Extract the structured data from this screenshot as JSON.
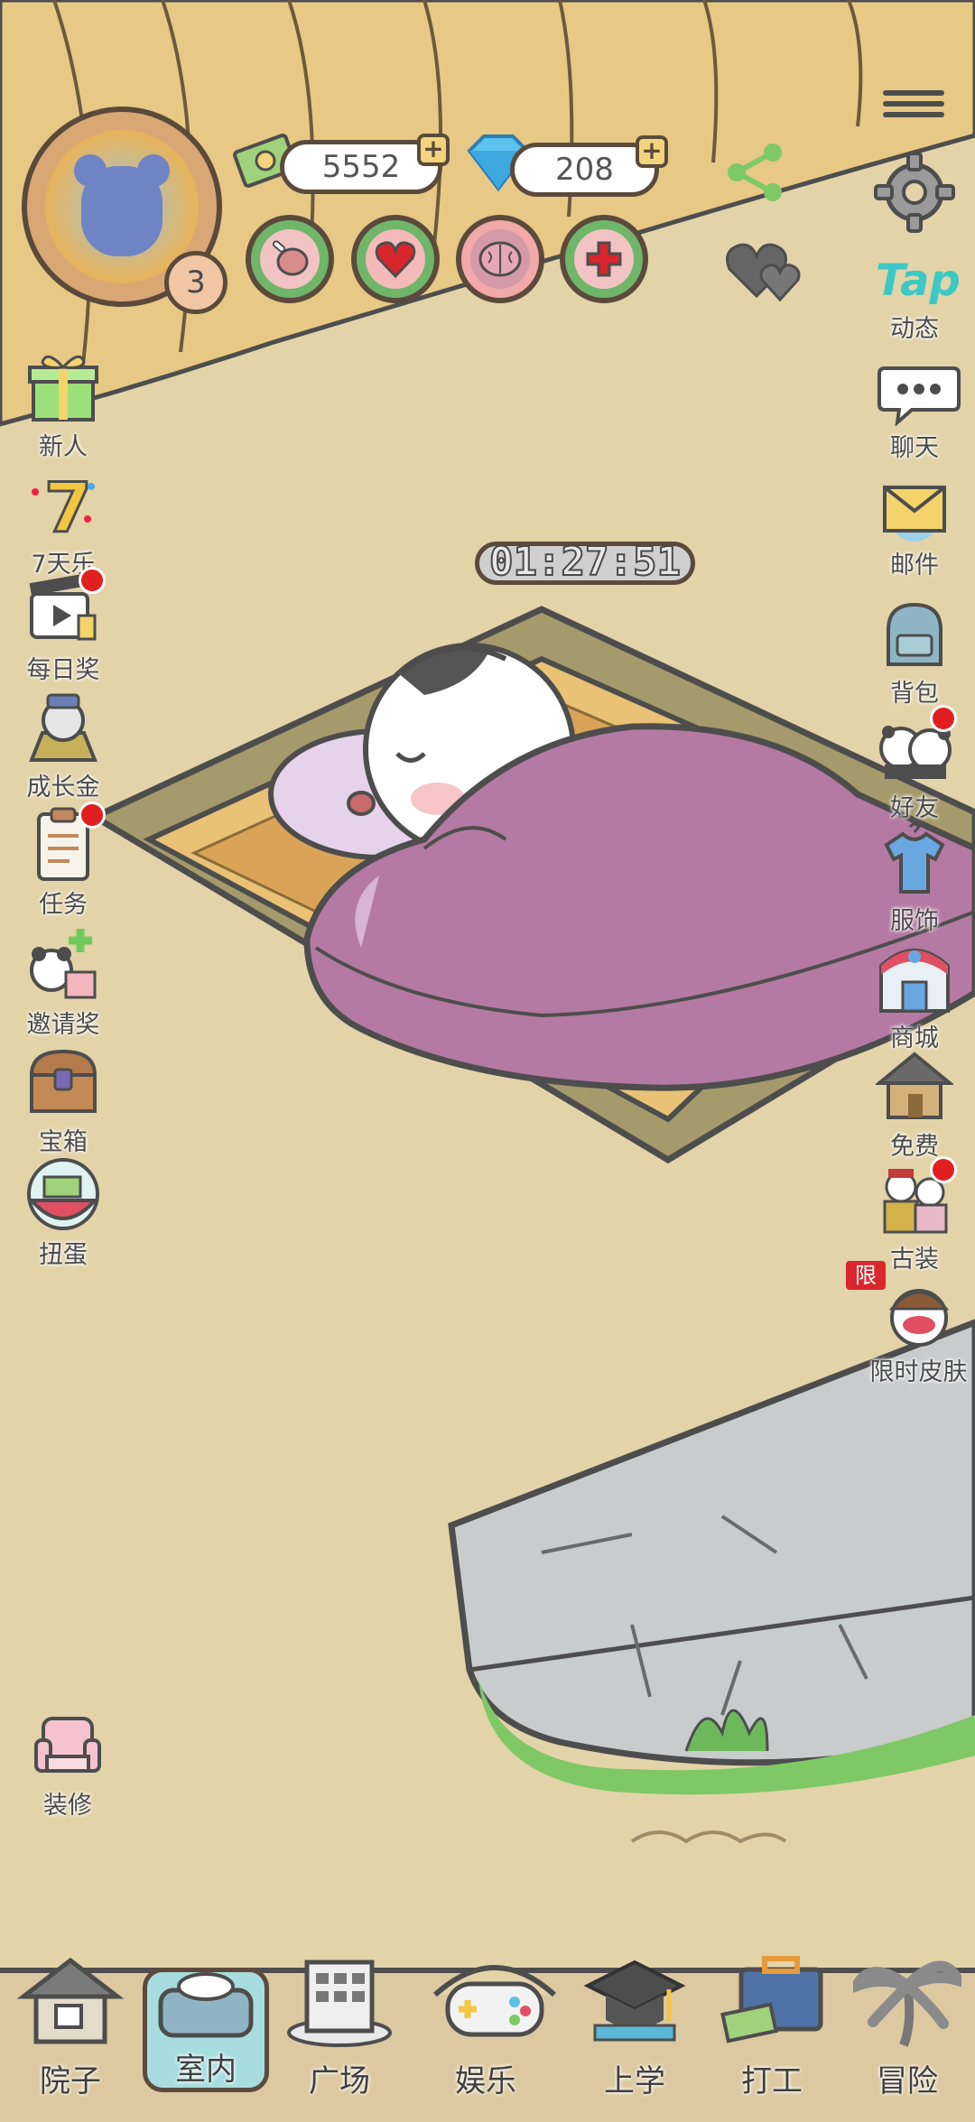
{
  "player": {
    "level": "3"
  },
  "currency": {
    "coins": "5552",
    "gems": "208"
  },
  "stats": [
    "food",
    "health",
    "brain",
    "add"
  ],
  "timer": "01:27:51",
  "left_menu": [
    {
      "label": "新人",
      "icon": "gift-icon",
      "dot": false
    },
    {
      "label": "7天乐",
      "icon": "seven-day-icon",
      "dot": false
    },
    {
      "label": "每日奖",
      "icon": "video-reward-icon",
      "dot": true
    },
    {
      "label": "成长金",
      "icon": "growth-fund-icon",
      "dot": false
    },
    {
      "label": "任务",
      "icon": "task-clipboard-icon",
      "dot": true
    },
    {
      "label": "邀请奖",
      "icon": "invite-icon",
      "dot": false
    },
    {
      "label": "宝箱",
      "icon": "treasure-chest-icon",
      "dot": false
    },
    {
      "label": "扭蛋",
      "icon": "gacha-icon",
      "dot": false
    }
  ],
  "right_menu": [
    {
      "label": "动态",
      "icon": "tap-icon",
      "dot": false,
      "badge": "Tap"
    },
    {
      "label": "聊天",
      "icon": "chat-icon",
      "dot": false
    },
    {
      "label": "邮件",
      "icon": "mail-icon",
      "dot": false
    },
    {
      "label": "背包",
      "icon": "backpack-icon",
      "dot": false
    },
    {
      "label": "好友",
      "icon": "friends-icon",
      "dot": true
    },
    {
      "label": "服饰",
      "icon": "clothes-icon",
      "dot": false
    },
    {
      "label": "商城",
      "icon": "shop-icon",
      "dot": false
    },
    {
      "label": "免费",
      "icon": "free-house-icon",
      "dot": false
    },
    {
      "label": "古装",
      "icon": "ancient-costume-icon",
      "dot": true
    },
    {
      "label": "限时皮肤",
      "icon": "limited-skin-icon",
      "dot": false,
      "tag": "限"
    }
  ],
  "decorate": {
    "label": "装修"
  },
  "bottom_nav": [
    {
      "label": "院子",
      "icon": "yard-house-icon",
      "active": false
    },
    {
      "label": "室内",
      "icon": "indoor-bed-icon",
      "active": true
    },
    {
      "label": "广场",
      "icon": "plaza-building-icon",
      "active": false
    },
    {
      "label": "娱乐",
      "icon": "gamepad-icon",
      "active": false
    },
    {
      "label": "上学",
      "icon": "graduation-cap-icon",
      "active": false
    },
    {
      "label": "打工",
      "icon": "briefcase-icon",
      "active": false
    },
    {
      "label": "冒险",
      "icon": "palm-tree-icon",
      "active": false
    }
  ],
  "colors": {
    "background": "#e3d3a9",
    "outline": "#5b4a3b",
    "blanket": "#b47aa3",
    "active_tab": "#a8dde0",
    "alert": "#e21f1f"
  }
}
